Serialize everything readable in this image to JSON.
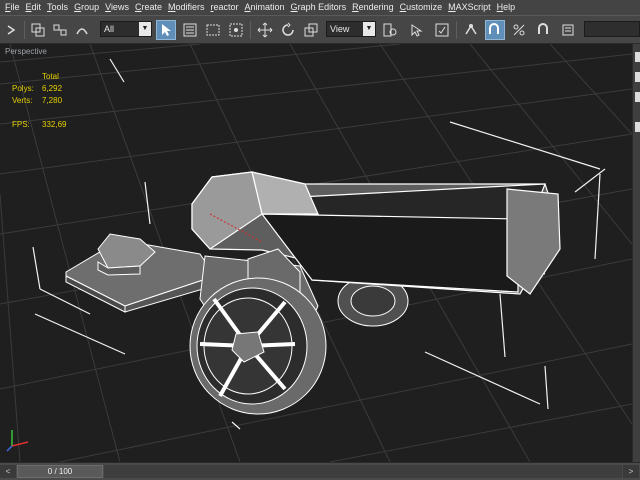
{
  "menu": [
    "File",
    "Edit",
    "Tools",
    "Group",
    "Views",
    "Create",
    "Modifiers",
    "reactor",
    "Animation",
    "Graph Editors",
    "Rendering",
    "Customize",
    "MAXScript",
    "Help"
  ],
  "toolbar": {
    "selection_filter": "All",
    "reference_coord": "View",
    "icons": [
      "undo-icon",
      "select-link-icon",
      "unlink-icon",
      "bind-spacewarp-icon",
      "select-object-icon",
      "select-by-name-icon",
      "rect-selection-icon",
      "window-crossing-icon",
      "move-icon",
      "rotate-icon",
      "scale-icon",
      "pivot-icon",
      "select-manipulate-icon",
      "keyboard-shortcut-icon",
      "snap-3d-icon",
      "angle-snap-icon",
      "percent-snap-icon",
      "spinner-snap-icon"
    ]
  },
  "viewport": {
    "label": "Perspective",
    "stats": {
      "header": "Total",
      "polys_label": "Polys:",
      "polys_value": "6,292",
      "verts_label": "Verts:",
      "verts_value": "7,280",
      "fps_label": "FPS:",
      "fps_value": "332,69"
    }
  },
  "time_slider": {
    "position": "0 / 100",
    "prev": "<",
    "next": ">"
  },
  "colors": {
    "menu_bg": "#444444",
    "viewport_bg": "#1f1f1f",
    "grid": "#3a3a3a",
    "stats_text": "#e6d200",
    "active_tool": "#5f8fb8"
  }
}
